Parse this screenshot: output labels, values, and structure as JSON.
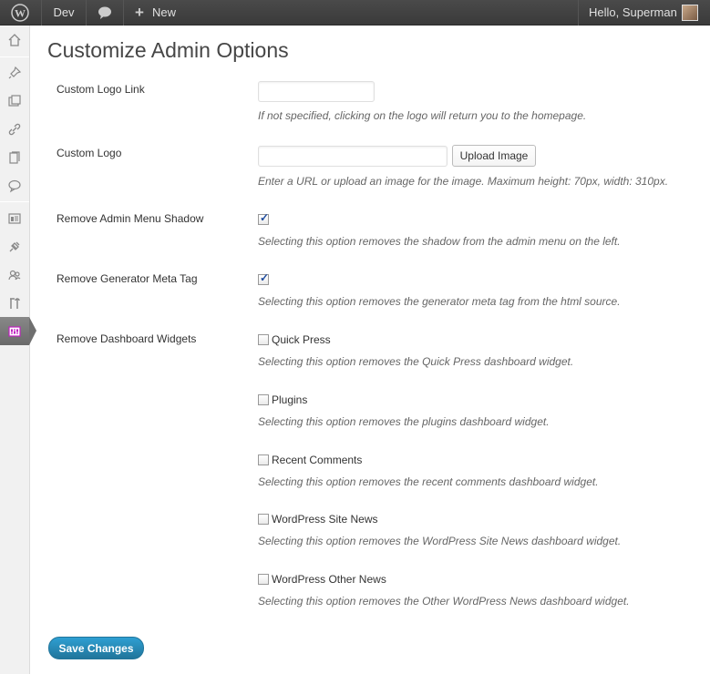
{
  "adminbar": {
    "site_name": "Dev",
    "new_label": "New",
    "greeting": "Hello, Superman"
  },
  "sidebar": {
    "icons": [
      "dashboard-icon",
      "posts-icon",
      "media-icon",
      "links-icon",
      "pages-icon",
      "comments-icon",
      "appearance-icon",
      "plugins-icon",
      "users-icon",
      "tools-icon",
      "settings-icon"
    ]
  },
  "page": {
    "title": "Customize Admin Options"
  },
  "form": {
    "logo_link": {
      "label": "Custom Logo Link",
      "value": "",
      "description": "If not specified, clicking on the logo will return you to the homepage."
    },
    "logo": {
      "label": "Custom Logo",
      "value": "",
      "button": "Upload Image",
      "description": "Enter a URL or upload an image for the image. Maximum height: 70px, width: 310px."
    },
    "menu_shadow": {
      "label": "Remove Admin Menu Shadow",
      "checked": true,
      "description": "Selecting this option removes the shadow from the admin menu on the left."
    },
    "generator_tag": {
      "label": "Remove Generator Meta Tag",
      "checked": true,
      "description": "Selecting this option removes the generator meta tag from the html source."
    },
    "widgets": {
      "label": "Remove Dashboard Widgets",
      "items": [
        {
          "label": "Quick Press",
          "checked": false,
          "description": "Selecting this option removes the Quick Press dashboard widget."
        },
        {
          "label": "Plugins",
          "checked": false,
          "description": "Selecting this option removes the plugins dashboard widget."
        },
        {
          "label": "Recent Comments",
          "checked": false,
          "description": "Selecting this option removes the recent comments dashboard widget."
        },
        {
          "label": "WordPress Site News",
          "checked": false,
          "description": "Selecting this option removes the WordPress Site News dashboard widget."
        },
        {
          "label": "WordPress Other News",
          "checked": false,
          "description": "Selecting this option removes the Other WordPress News dashboard widget."
        }
      ]
    },
    "save_label": "Save Changes"
  }
}
